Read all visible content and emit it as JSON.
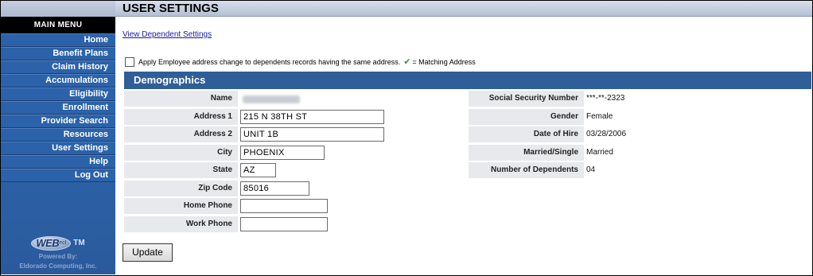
{
  "header": {
    "title": "USER SETTINGS"
  },
  "sidebar": {
    "menu_title": "MAIN MENU",
    "items": [
      {
        "label": "Home"
      },
      {
        "label": "Benefit Plans"
      },
      {
        "label": "Claim History"
      },
      {
        "label": "Accumulations"
      },
      {
        "label": "Eligibility"
      },
      {
        "label": "Enrollment"
      },
      {
        "label": "Provider Search"
      },
      {
        "label": "Resources"
      },
      {
        "label": "User Settings"
      },
      {
        "label": "Help"
      },
      {
        "label": "Log Out"
      }
    ],
    "logo": {
      "brand": "WEB",
      "brand_suffix": "ecl",
      "tm": "TM",
      "powered_by": "Powered By:",
      "company": "Eldorado Computing, Inc."
    }
  },
  "links": {
    "view_dependent": "View Dependent Settings"
  },
  "apply": {
    "checked": false,
    "text": "Apply Employee address change to dependents records having the same address.",
    "check_symbol": "✔",
    "matching_text": "= Matching Address"
  },
  "demographics": {
    "title": "Demographics",
    "left": {
      "name_label": "Name",
      "address1_label": "Address 1",
      "address1_value": "215 N 38TH ST",
      "address2_label": "Address 2",
      "address2_value": "UNIT 1B",
      "city_label": "City",
      "city_value": "PHOENIX",
      "state_label": "State",
      "state_value": "AZ",
      "zip_label": "Zip Code",
      "zip_value": "85016",
      "home_phone_label": "Home Phone",
      "home_phone_value": "",
      "work_phone_label": "Work Phone",
      "work_phone_value": ""
    },
    "right": {
      "ssn_label": "Social Security Number",
      "ssn_value": "***-**-2323",
      "gender_label": "Gender",
      "gender_value": "Female",
      "hire_label": "Date of Hire",
      "hire_value": "03/28/2006",
      "marital_label": "Married/Single",
      "marital_value": "Married",
      "dependents_label": "Number of Dependents",
      "dependents_value": "04"
    }
  },
  "buttons": {
    "update": "Update"
  },
  "colors": {
    "sidebar_blue": "#2b62a9",
    "section_header_blue": "#2f5e99",
    "label_bg": "#e7e9ed",
    "check_green": "#2b9a2b",
    "link_blue": "#1a1aa6"
  }
}
